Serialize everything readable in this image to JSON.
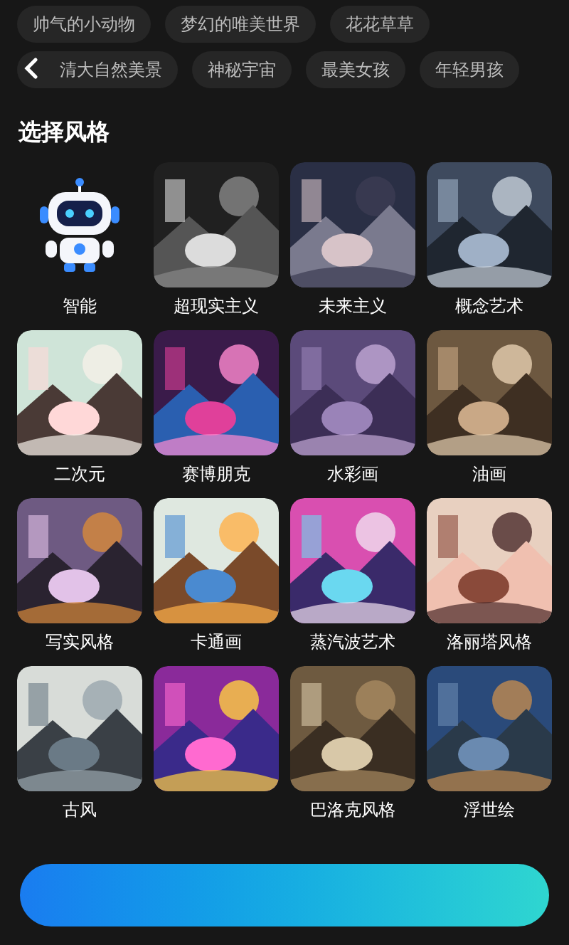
{
  "tag_rows": [
    [
      "帅气的小动物",
      "梦幻的唯美世界",
      "花花草草"
    ],
    [
      "清大自然美景",
      "神秘宇宙",
      "最美女孩",
      "年轻男孩"
    ]
  ],
  "section_title": "选择风格",
  "styles": [
    {
      "label": "智能",
      "kind": "robot"
    },
    {
      "label": "超现实主义",
      "kind": "picture"
    },
    {
      "label": "未来主义",
      "kind": "picture"
    },
    {
      "label": "概念艺术",
      "kind": "picture"
    },
    {
      "label": "二次元",
      "kind": "picture"
    },
    {
      "label": "赛博朋克",
      "kind": "picture"
    },
    {
      "label": "水彩画",
      "kind": "picture"
    },
    {
      "label": "油画",
      "kind": "picture"
    },
    {
      "label": "写实风格",
      "kind": "picture"
    },
    {
      "label": "卡通画",
      "kind": "picture"
    },
    {
      "label": "蒸汽波艺术",
      "kind": "picture"
    },
    {
      "label": "洛丽塔风格",
      "kind": "picture"
    },
    {
      "label": "古风",
      "kind": "picture"
    },
    {
      "kind": "picture"
    },
    {
      "label": "巴洛克风格",
      "kind": "picture"
    },
    {
      "label": "浮世绘",
      "kind": "picture"
    }
  ]
}
